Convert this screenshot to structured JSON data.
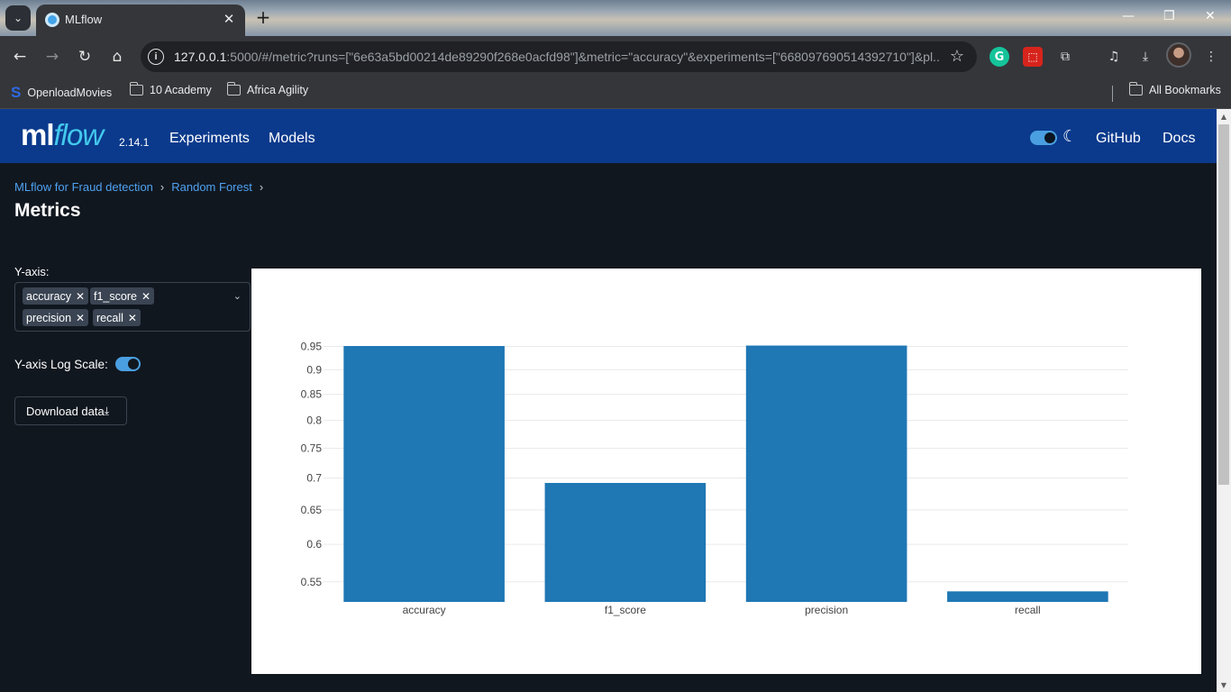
{
  "browser": {
    "tab_title": "MLflow",
    "url_host": "127.0.0.1",
    "url_rest": ":5000/#/metric?runs=[\"6e63a5bd00214de89290f268e0acfd98\"]&metric=\"accuracy\"&experiments=[\"668097690514392710\"]&pl...",
    "bookmarks": [
      "OpenloadMovies",
      "10 Academy",
      "Africa Agility"
    ],
    "all_bookmarks": "All Bookmarks"
  },
  "header": {
    "logo_ml": "ml",
    "logo_flow": "flow",
    "version": "2.14.1",
    "nav": [
      "Experiments",
      "Models"
    ],
    "right_links": [
      "GitHub",
      "Docs"
    ]
  },
  "breadcrumb": [
    "MLflow for Fraud detection",
    "Random Forest"
  ],
  "page_title": "Metrics",
  "controls": {
    "yaxis_label": "Y-axis:",
    "selected_metrics": [
      "accuracy",
      "f1_score",
      "precision",
      "recall"
    ],
    "log_scale_label": "Y-axis Log Scale:",
    "log_scale_on": true,
    "download_label": "Download data"
  },
  "colors": {
    "bar": "#1f77b4",
    "header": "#0b3a8c",
    "link": "#4ea2f2"
  },
  "chart_data": {
    "type": "bar",
    "categories": [
      "accuracy",
      "f1_score",
      "precision",
      "recall"
    ],
    "values": [
      0.951,
      0.692,
      0.952,
      0.538
    ],
    "yscale": "log",
    "ylim": [
      0.525,
      1.0
    ],
    "yticks": [
      0.55,
      0.6,
      0.65,
      0.7,
      0.75,
      0.8,
      0.85,
      0.9,
      0.95
    ],
    "ytick_labels": [
      "0.55",
      "0.6",
      "0.65",
      "0.7",
      "0.75",
      "0.8",
      "0.85",
      "0.9",
      "0.95"
    ],
    "grid": true
  }
}
